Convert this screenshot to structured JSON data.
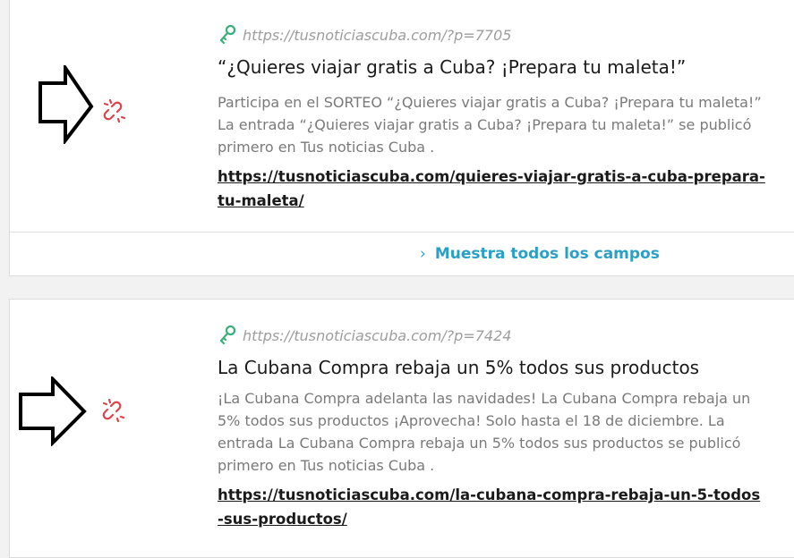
{
  "colors": {
    "accent": "#2aa0c7",
    "unlink_icon": "#e0414a",
    "key_icon": "#3cae7b",
    "muted_text": "#7a7a7a",
    "url_text": "#9e9e9e"
  },
  "entries": [
    {
      "icon_left": "arrow-right-icon",
      "icon_status": "broken-link-icon",
      "icon_url": "key-icon",
      "url": "https://tusnoticiascuba.com/?p=7705",
      "title": "“¿Quieres viajar gratis a Cuba? ¡Prepara tu maleta!”",
      "excerpt": "Participa en el SORTEO “¿Quieres viajar gratis a Cuba? ¡Prepara tu maleta!” La entrada “¿Quieres viajar gratis a Cuba? ¡Prepara tu maleta!” se publicó primero en Tus noticias Cuba .",
      "link": "https://tusnoticiascuba.com/quieres-viajar-gratis-a-cuba-prepara-tu-maleta/",
      "show_all_label": "Muestra todos los campos"
    },
    {
      "icon_left": "arrow-right-icon",
      "icon_status": "broken-link-icon",
      "icon_url": "key-icon",
      "url": "https://tusnoticiascuba.com/?p=7424",
      "title": "La Cubana Compra rebaja un 5% todos sus productos",
      "excerpt": "¡La Cubana Compra adelanta las navidades! La Cubana Compra rebaja un 5% todos sus productos ¡Aprovecha! Solo hasta el 18 de diciembre. La entrada La Cubana Compra rebaja un 5% todos sus productos se publicó primero en Tus noticias Cuba .",
      "link": "https://tusnoticiascuba.com/la-cubana-compra-rebaja-un-5-todos-sus-productos/"
    }
  ]
}
